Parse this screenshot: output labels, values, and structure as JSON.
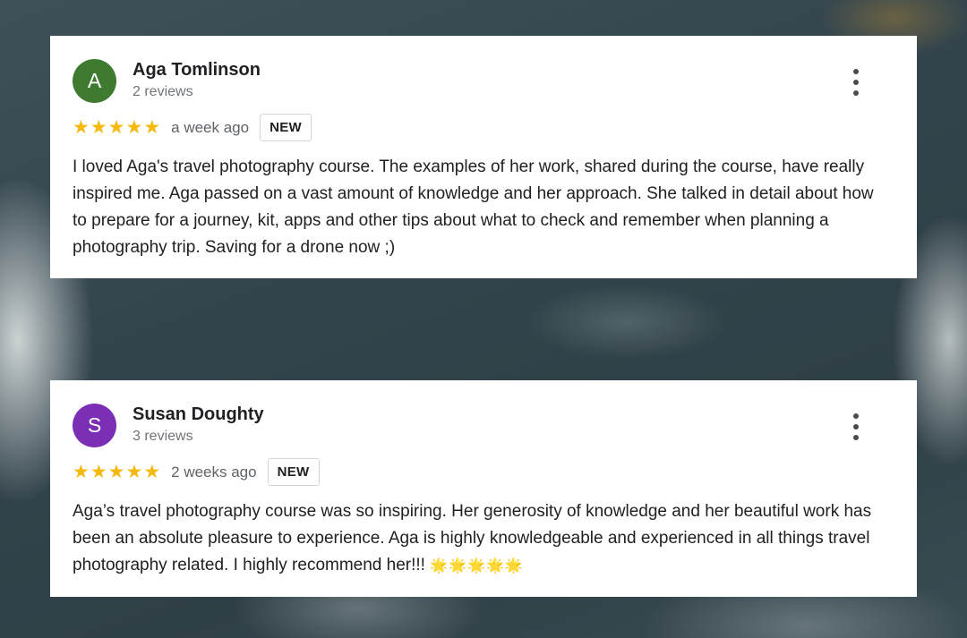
{
  "reviews": [
    {
      "initial": "A",
      "avatar_color": "#3e7a2f",
      "name": "Aga Tomlinson",
      "review_count": "2 reviews",
      "stars": [
        "★",
        "★",
        "★",
        "★",
        "★"
      ],
      "time": "a week ago",
      "badge": "NEW",
      "text": "I loved Aga's travel photography course. The examples of her work, shared during the course, have really inspired me. Aga passed on a vast amount of knowledge and her approach. She talked in detail about how to prepare for a journey, kit, apps and other tips about what to check and remember when planning a photography trip. Saving for a drone now ;)",
      "emoji": ""
    },
    {
      "initial": "S",
      "avatar_color": "#7b2fb5",
      "name": "Susan Doughty",
      "review_count": "3 reviews",
      "stars": [
        "★",
        "★",
        "★",
        "★",
        "★"
      ],
      "time": "2 weeks ago",
      "badge": "NEW",
      "text": "Aga’s travel photography course was so inspiring. Her generosity of knowledge and her beautiful work has been an absolute pleasure to experience. Aga is highly knowledgeable and experienced in all things travel photography related. I highly recommend her!!! ",
      "emoji": "🌟🌟🌟🌟🌟"
    }
  ],
  "colors": {
    "star": "#f5b80c",
    "card_bg": "#ffffff"
  }
}
